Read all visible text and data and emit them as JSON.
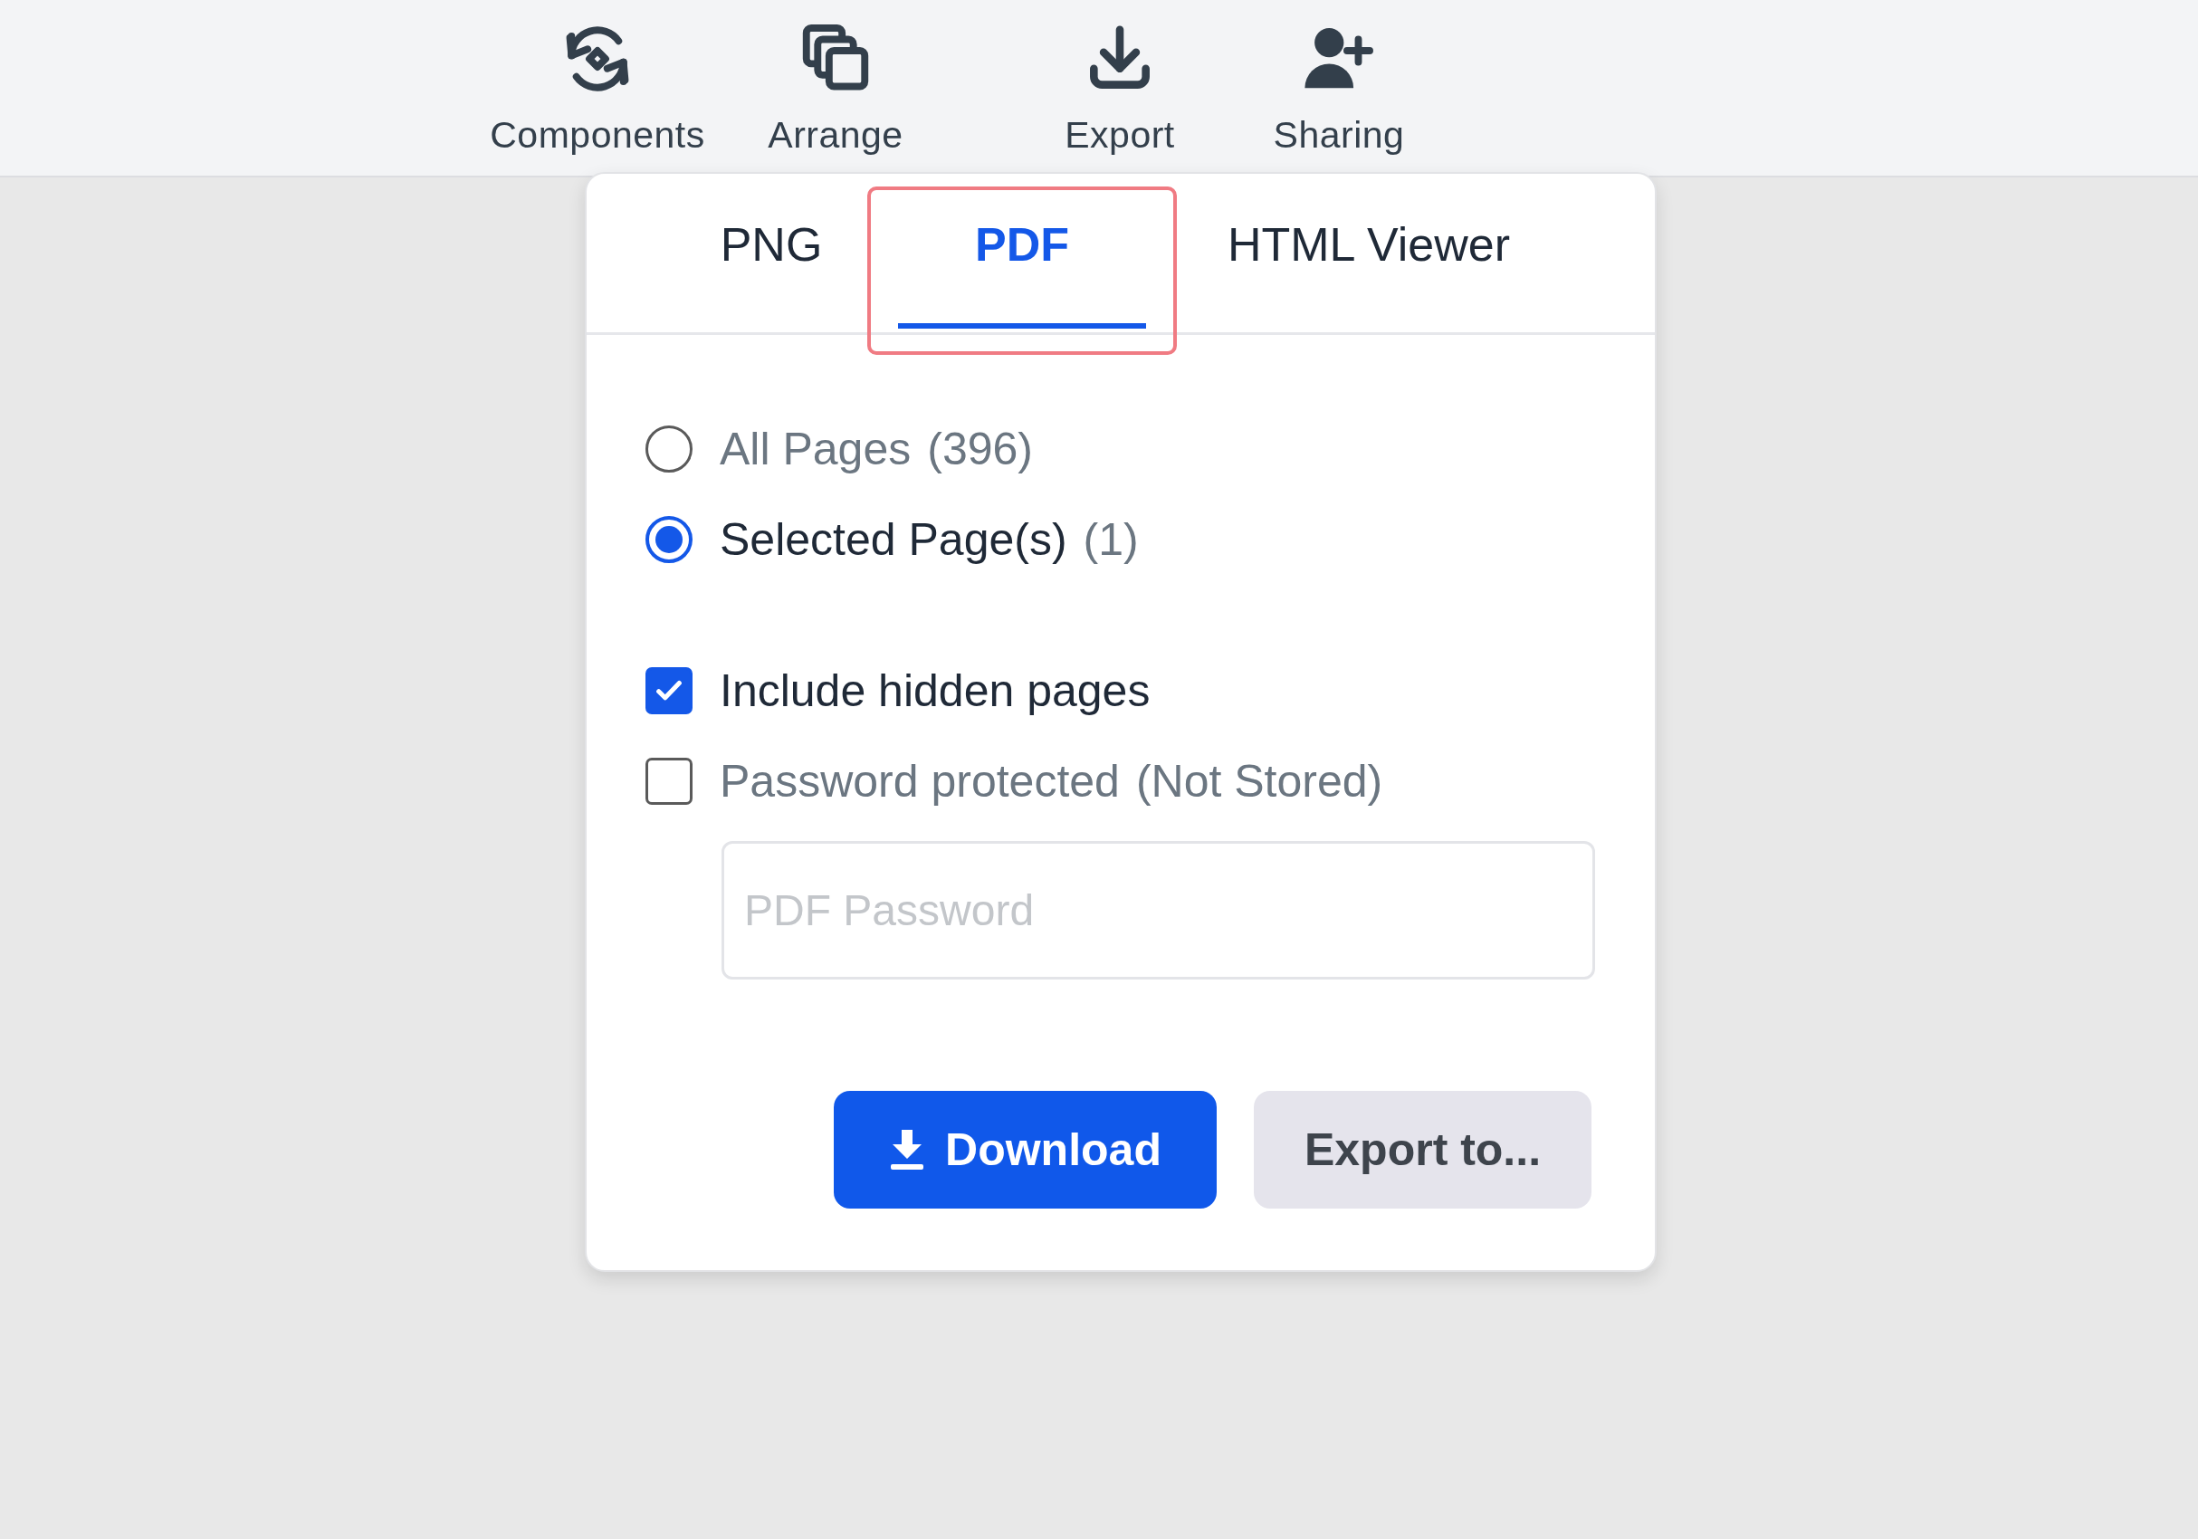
{
  "toolbar": {
    "items": [
      {
        "label": "Components",
        "kind": "components"
      },
      {
        "label": "Arrange",
        "kind": "arrange"
      },
      {
        "label": "Export",
        "kind": "export"
      },
      {
        "label": "Sharing",
        "kind": "sharing"
      }
    ]
  },
  "export_panel": {
    "tabs": [
      {
        "label": "PNG",
        "selected": false,
        "highlighted": false
      },
      {
        "label": "PDF",
        "selected": true,
        "highlighted": true
      },
      {
        "label": "HTML Viewer",
        "selected": false,
        "highlighted": false
      }
    ],
    "page_range": [
      {
        "label": "All Pages",
        "count": "(396)",
        "selected": false
      },
      {
        "label": "Selected Page(s)",
        "count": "(1)",
        "selected": true
      }
    ],
    "options": [
      {
        "label": "Include hidden pages",
        "checked": true
      },
      {
        "label": "Password protected",
        "note": "(Not Stored)",
        "checked": false
      }
    ],
    "password_field": {
      "placeholder": "PDF Password"
    },
    "buttons": [
      {
        "label": "Download",
        "kind": "primary"
      },
      {
        "label": "Export to...",
        "kind": "secondary"
      }
    ]
  }
}
